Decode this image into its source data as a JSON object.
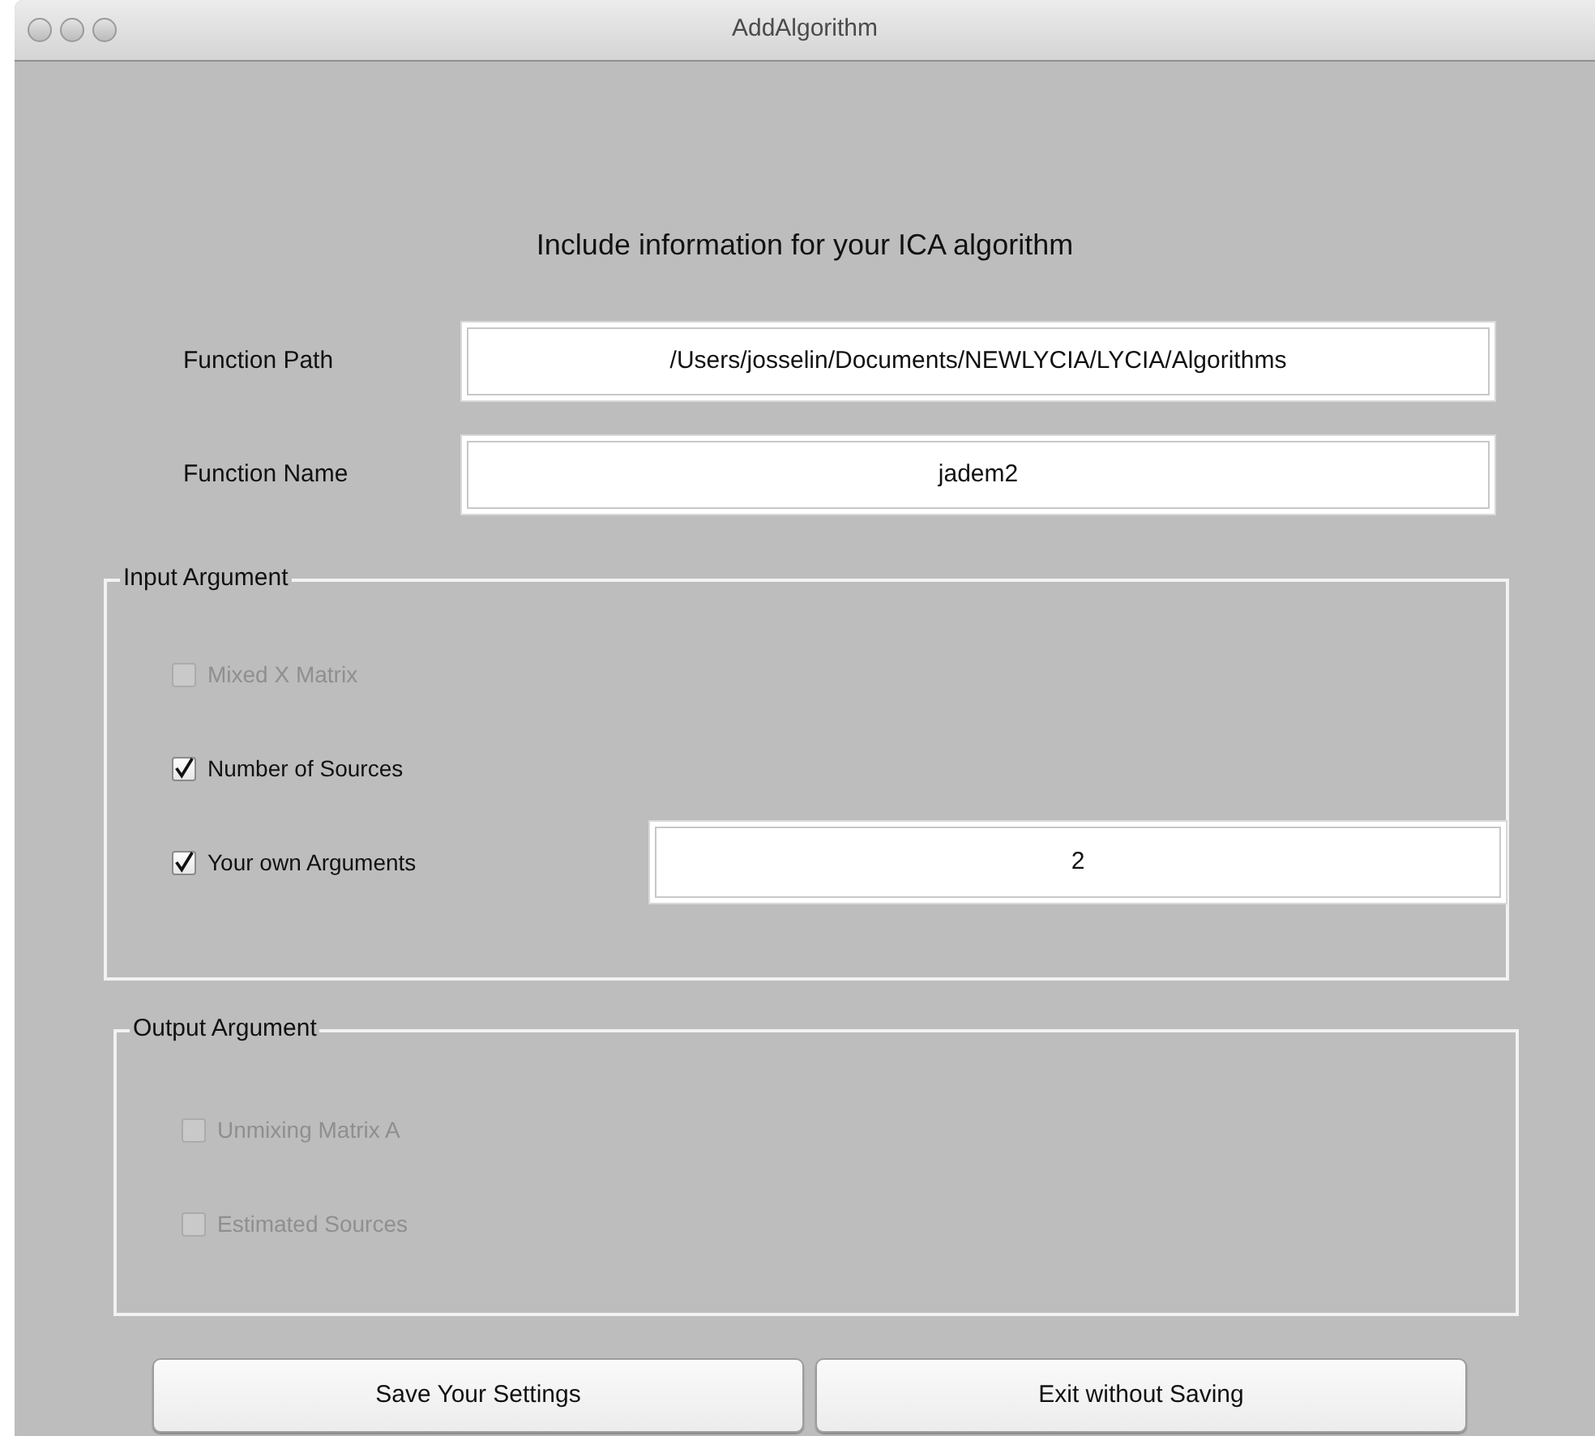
{
  "window": {
    "title": "AddAlgorithm"
  },
  "heading": "Include information for your ICA algorithm",
  "fields": [
    {
      "label": "Function Path",
      "value": "/Users/josselin/Documents/NEWLYCIA/LYCIA/Algorithms"
    },
    {
      "label": "Function Name",
      "value": "jadem2"
    }
  ],
  "groups": [
    {
      "title": "Input Argument",
      "options": [
        {
          "label": "Mixed X Matrix",
          "checked": false,
          "disabled": true
        },
        {
          "label": "Number of Sources",
          "checked": true,
          "disabled": false
        },
        {
          "label": "Your own Arguments",
          "checked": true,
          "disabled": false,
          "value": "2"
        }
      ]
    },
    {
      "title": "Output Argument",
      "options": [
        {
          "label": "Unmixing Matrix A",
          "checked": false,
          "disabled": true
        },
        {
          "label": "Estimated Sources",
          "checked": false,
          "disabled": true
        }
      ]
    }
  ],
  "buttons": [
    "Save Your Settings",
    "Exit without Saving"
  ]
}
